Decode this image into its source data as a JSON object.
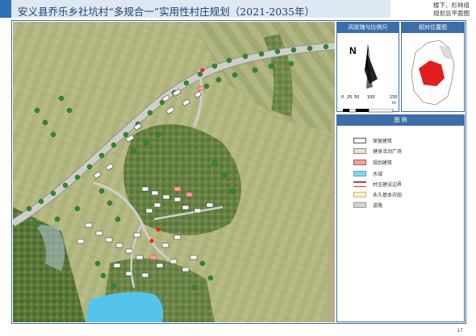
{
  "header": {
    "title": "安义县乔乐乡社坑村“多规合一”实用性村庄规划（2021-2035年）",
    "sheet_title_line1": "楼下、杉林组",
    "sheet_title_line2": "规划总平面图"
  },
  "panels": {
    "compass_title": "风玫瑰与比例尺",
    "location_title": "相对位置图",
    "legend_title": "图  例",
    "north_label": "N",
    "scale_labels": [
      "0",
      "25",
      "50",
      "100",
      "150"
    ],
    "scale_unit": "m"
  },
  "legend": [
    {
      "label": "保留建筑",
      "fill": "#ffffff",
      "stroke": "#555555"
    },
    {
      "label": "健身活动广场",
      "fill": "#efe4c9",
      "stroke": "#888888"
    },
    {
      "label": "规划建筑",
      "fill": "#f0a3a3",
      "stroke": "#c94a4a"
    },
    {
      "label": "水域",
      "fill": "#8fd3ee",
      "stroke": "#4aa8d0"
    },
    {
      "label": "村庄建设边界",
      "fill": "#ffffff",
      "stroke": "#d13a3a"
    },
    {
      "label": "永久基本农田",
      "fill": "#f8f0c8",
      "stroke": "#c9b86a"
    },
    {
      "label": "道路",
      "fill": "#d4d4d4",
      "stroke": "#9a9a9a"
    }
  ],
  "page_number": "17",
  "colors": {
    "accent": "#3d6ea9",
    "road": "#c9c9c4",
    "water": "#5fc4e8",
    "tree": "#2f8a2f",
    "farmland": "#a9b27a",
    "location_highlight": "#e11d1d"
  }
}
